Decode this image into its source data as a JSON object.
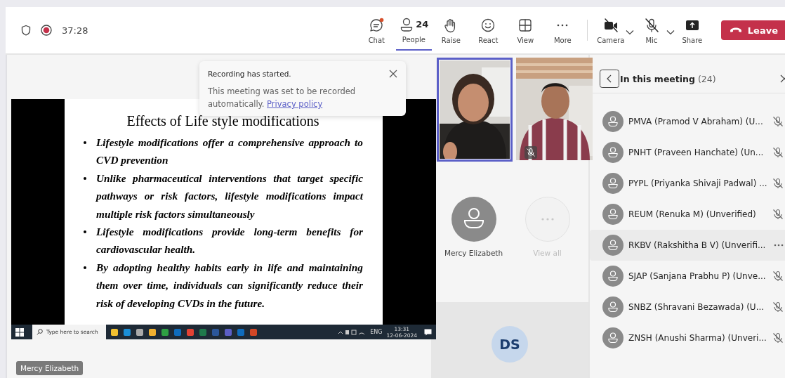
{
  "toolbar": {
    "recording": {
      "on": true
    },
    "timer": "37:28",
    "buttons": [
      {
        "kind": "chat",
        "label": "Chat",
        "notification": true,
        "selected": false
      },
      {
        "kind": "people",
        "label": "People",
        "count": "24",
        "selected": true
      },
      {
        "kind": "raise",
        "label": "Raise",
        "selected": false
      },
      {
        "kind": "react",
        "label": "React",
        "selected": false
      },
      {
        "kind": "view",
        "label": "View",
        "selected": false
      },
      {
        "kind": "more",
        "label": "More",
        "selected": false
      }
    ],
    "devices": [
      {
        "kind": "camera",
        "label": "Camera",
        "off": true,
        "menu": true
      },
      {
        "kind": "mic",
        "label": "Mic",
        "off": true,
        "menu": true
      },
      {
        "kind": "share",
        "label": "Share",
        "off": false,
        "menu": false
      }
    ],
    "leave_button": "Leave"
  },
  "toast": {
    "title": "Recording has started.",
    "message": "This meeting was set to be recorded automatically.",
    "link": "Privacy policy"
  },
  "slide": {
    "title": "Effects of Life style modifications",
    "bullets": [
      "Lifestyle modifications offer a comprehensive approach to CVD prevention",
      "Unlike pharmaceutical interventions that target specific pathways or risk factors, lifestyle modifications impact multiple risk factors simultaneously",
      "Lifestyle modifications provide long-term benefits for cardiovascular health.",
      " By adopting healthy habits early in life and maintaining them over time, individuals can significantly reduce their risk of developing CVDs in the future."
    ]
  },
  "shared_taskbar": {
    "search_placeholder": "Type here to search",
    "language": "ENG",
    "time": "13:31",
    "date": "12-06-2024"
  },
  "presenter_label": "Mercy Elizabeth",
  "videos": [
    {
      "kind": "picture",
      "active": true,
      "muted": false
    },
    {
      "kind": "picture",
      "active": false,
      "muted": true
    }
  ],
  "avatars": [
    {
      "kind": "person",
      "name": "Mercy Elizabeth"
    },
    {
      "kind": "more",
      "name": "View all"
    }
  ],
  "initials_tile": "DS",
  "panel": {
    "title": "In this meeting",
    "count": "(24)",
    "participants": [
      {
        "name": "PMVA (Pramod V Abraham) (U...",
        "muted": true,
        "highlighted": false
      },
      {
        "name": "PNHT (Praveen Hanchate) (Un...",
        "muted": true,
        "highlighted": false
      },
      {
        "name": "PYPL (Priyanka Shivaji Padwal) ...",
        "muted": true,
        "highlighted": false
      },
      {
        "name": "REUM (Renuka M) (Unverified)",
        "muted": true,
        "highlighted": false
      },
      {
        "name": "RKBV (Rakshitha B V) (Unverifi...",
        "highlighted": true
      },
      {
        "name": "SJAP (Sanjana Prabhu P) (Unve...",
        "muted": true,
        "highlighted": false
      },
      {
        "name": "SNBZ (Shravani Bezawada) (U...",
        "muted": true,
        "highlighted": false
      },
      {
        "name": "ZNSH (Anushi Sharma) (Unveri...",
        "muted": true,
        "highlighted": false
      }
    ]
  }
}
